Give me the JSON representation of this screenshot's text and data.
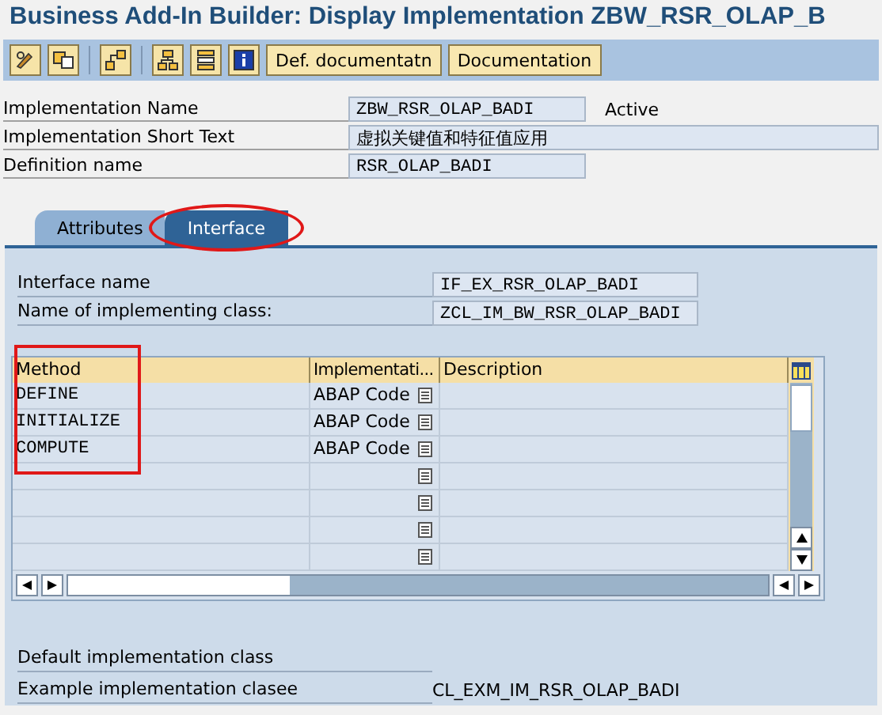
{
  "window": {
    "title": "Business Add-In Builder: Display Implementation ZBW_RSR_OLAP_B"
  },
  "toolbar": {
    "icon_groups": [
      [
        {
          "kind": "edit"
        },
        {
          "kind": "copy"
        }
      ],
      [
        {
          "kind": "navigate"
        }
      ],
      [
        {
          "kind": "hierarchy"
        },
        {
          "kind": "stack"
        },
        {
          "kind": "info"
        }
      ]
    ],
    "buttons": [
      "Def. documentatn",
      "Documentation"
    ]
  },
  "header_fields": [
    {
      "label": "Implementation Name",
      "value": "ZBW_RSR_OLAP_BADI",
      "status": "Active",
      "wide": false
    },
    {
      "label": "Implementation Short Text",
      "value": "虚拟关键值和特征值应用",
      "wide": true
    },
    {
      "label": "Definition name",
      "value": "RSR_OLAP_BADI",
      "wide": false
    }
  ],
  "tabs": [
    {
      "label": "Attributes",
      "selected": false,
      "highlighted": false
    },
    {
      "label": "Interface",
      "selected": true,
      "highlighted": true
    }
  ],
  "interface_fields": [
    {
      "label": "Interface name",
      "value": "IF_EX_RSR_OLAP_BADI"
    },
    {
      "label": "Name of implementing class:",
      "value": "ZCL_IM_BW_RSR_OLAP_BADI"
    }
  ],
  "table": {
    "columns": [
      {
        "label": "Method",
        "highlighted": true
      },
      {
        "label": "Implementati...",
        "highlighted": false
      },
      {
        "label": "Description",
        "highlighted": false
      }
    ],
    "rows": [
      {
        "method": "DEFINE",
        "implementation": "ABAP Code"
      },
      {
        "method": "INITIALIZE",
        "implementation": "ABAP Code"
      },
      {
        "method": "COMPUTE",
        "implementation": "ABAP Code"
      },
      {},
      {},
      {},
      {}
    ]
  },
  "footer_fields": [
    {
      "label": "Default implementation class"
    },
    {
      "label": "Example implementation clasee",
      "value": "CL_EXM_IM_RSR_OLAP_BADI"
    }
  ]
}
